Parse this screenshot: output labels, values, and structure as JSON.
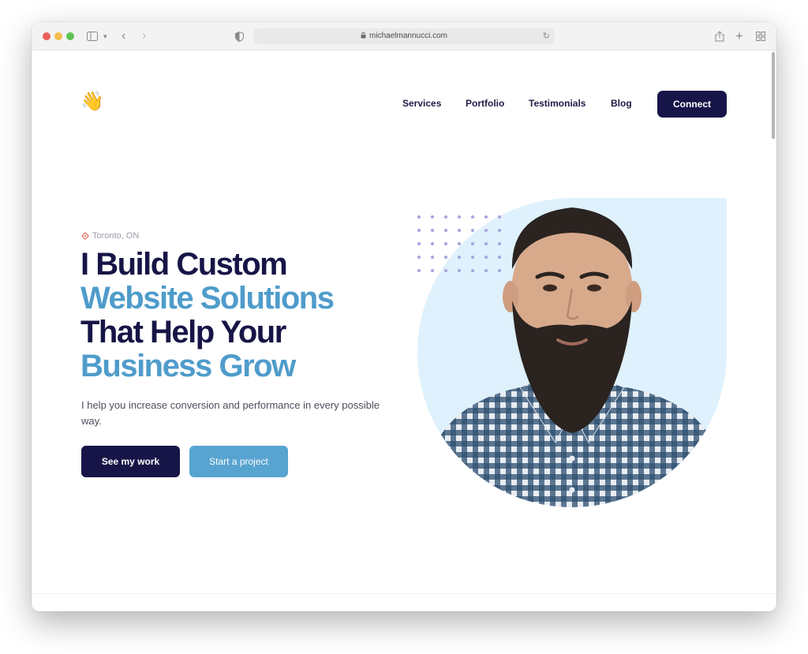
{
  "browser": {
    "url": "michaelmannucci.com"
  },
  "header": {
    "logo_emoji": "👋",
    "nav": [
      "Services",
      "Portfolio",
      "Testimonials",
      "Blog"
    ],
    "connect_label": "Connect"
  },
  "hero": {
    "location": "Toronto, ON",
    "headline": {
      "line1": "I Build Custom",
      "line2": "Website Solutions",
      "line3": "That Help Your",
      "line4": "Business Grow"
    },
    "subtitle": "I help you increase conversion and performance in every possible way.",
    "primary_button": "See my work",
    "secondary_button": "Start a project"
  },
  "colors": {
    "navy": "#171547",
    "blue": "#4f9ccb",
    "light_blue_bg": "#dff1fc"
  }
}
